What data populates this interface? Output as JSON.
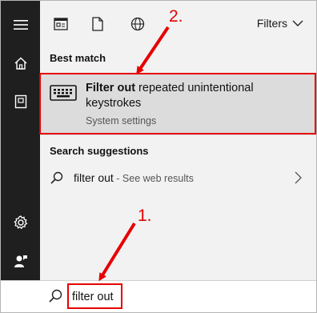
{
  "topbar": {
    "filters_label": "Filters",
    "icons": [
      "document-view-icon",
      "file-icon",
      "globe-icon"
    ]
  },
  "sidebar": {
    "icons": [
      "hamburger-menu-icon",
      "home-icon",
      "notebook-icon",
      "settings-gear-icon",
      "feedback-person-icon"
    ]
  },
  "best_match": {
    "heading": "Best match",
    "title_bold": "Filter out",
    "title_rest": " repeated unintentional keystrokes",
    "subtitle": "System settings"
  },
  "suggestions": {
    "heading": "Search suggestions",
    "items": [
      {
        "query": "filter out",
        "hint": " - See web results"
      }
    ]
  },
  "search": {
    "value": "filter out"
  },
  "annotations": {
    "step1": "1.",
    "step2": "2."
  },
  "colors": {
    "accent": "#e60000",
    "sidebar": "#1f1f1f",
    "panel": "#f2f2f2",
    "highlight": "#dcdcdc"
  }
}
